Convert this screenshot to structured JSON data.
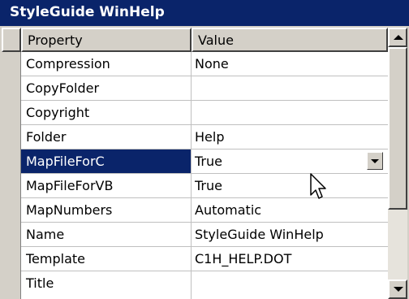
{
  "window": {
    "title": "StyleGuide WinHelp"
  },
  "grid": {
    "columns": [
      "Property",
      "Value"
    ],
    "rows": [
      {
        "property": "Compression",
        "value": "None"
      },
      {
        "property": "CopyFolder",
        "value": ""
      },
      {
        "property": "Copyright",
        "value": ""
      },
      {
        "property": "Folder",
        "value": "Help"
      },
      {
        "property": "MapFileForC",
        "value": "True",
        "selected": true,
        "has_dropdown": true
      },
      {
        "property": "MapFileForVB",
        "value": "True"
      },
      {
        "property": "MapNumbers",
        "value": "Automatic"
      },
      {
        "property": "Name",
        "value": "StyleGuide WinHelp"
      },
      {
        "property": "Template",
        "value": "C1H_HELP.DOT"
      },
      {
        "property": "Title",
        "value": ""
      }
    ]
  },
  "colors": {
    "title_bar": "#0a246a",
    "selection": "#0a246a",
    "face": "#d4d0c8"
  },
  "icons": {
    "dropdown": "chevron-down-icon",
    "scroll_up": "arrow-up-icon",
    "scroll_down": "arrow-down-icon",
    "cursor": "mouse-pointer-icon"
  }
}
